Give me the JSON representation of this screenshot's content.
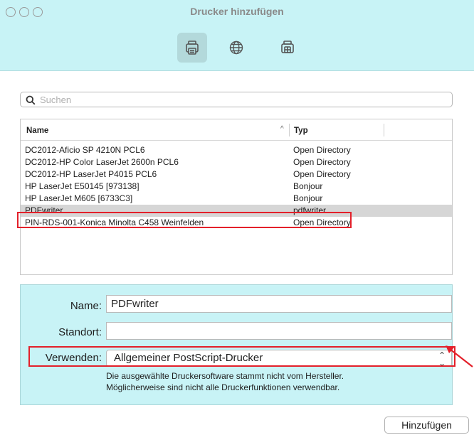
{
  "window": {
    "title": "Drucker hinzufügen",
    "toolbar": [
      {
        "icon": "default-printer-icon",
        "selected": true
      },
      {
        "icon": "ip-globe-icon",
        "selected": false
      },
      {
        "icon": "windows-printer-icon",
        "selected": false
      }
    ]
  },
  "search": {
    "placeholder": "Suchen",
    "value": ""
  },
  "list": {
    "columns": {
      "name": "Name",
      "type": "Typ"
    },
    "rows": [
      {
        "name": "DC2012-Aficio SP 4210N PCL6",
        "type": "Open Directory"
      },
      {
        "name": "DC2012-HP Color LaserJet 2600n PCL6",
        "type": "Open Directory"
      },
      {
        "name": "DC2012-HP LaserJet P4015 PCL6",
        "type": "Open Directory"
      },
      {
        "name": "HP LaserJet E50145 [973138]",
        "type": "Bonjour"
      },
      {
        "name": "HP LaserJet M605 [6733C3]",
        "type": "Bonjour"
      },
      {
        "name": "PDFwriter",
        "type": "pdfwriter",
        "selected": true
      },
      {
        "name": "PIN-RDS-001-Konica Minolta C458 Weinfelden",
        "type": "Open Directory"
      }
    ]
  },
  "details": {
    "name_label": "Name:",
    "name_value": "PDFwriter",
    "location_label": "Standort:",
    "location_value": "",
    "use_label": "Verwenden:",
    "use_value": "Allgemeiner PostScript-Drucker",
    "note_line1": "Die ausgewählte Druckersoftware stammt nicht vom Hersteller.",
    "note_line2": "Möglicherweise sind nicht alle Druckerfunktionen verwendbar."
  },
  "add_button": "Hinzufügen",
  "colors": {
    "panel": "#c8f3f6",
    "highlight": "#e3202a",
    "selected_row": "#d6d6d6"
  }
}
